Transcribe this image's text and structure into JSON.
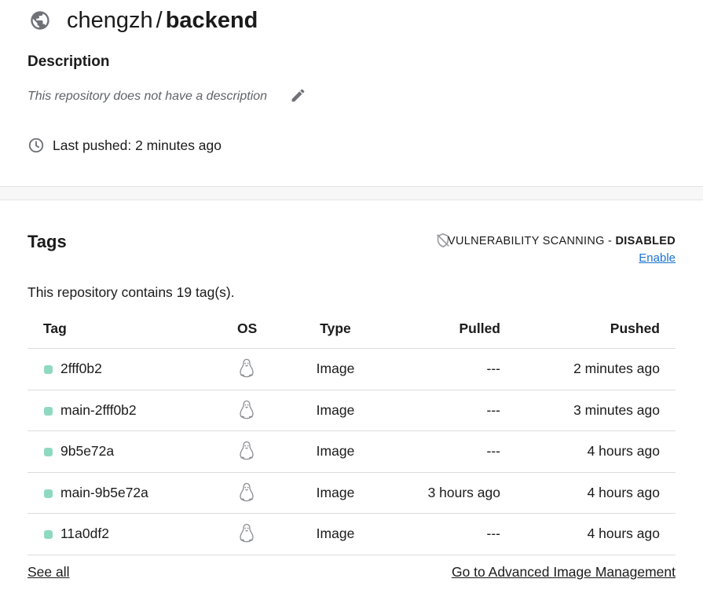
{
  "repo": {
    "namespace": "chengzh",
    "separator": "/",
    "name": "backend"
  },
  "description": {
    "heading": "Description",
    "text": "This repository does not have a description"
  },
  "last_pushed": "Last pushed: 2 minutes ago",
  "tags_section": {
    "heading": "Tags",
    "vulnerability_label": "VULNERABILITY SCANNING - ",
    "vulnerability_status": "DISABLED",
    "enable_link": "Enable",
    "count_text": "This repository contains 19 tag(s).",
    "columns": {
      "tag": "Tag",
      "os": "OS",
      "type": "Type",
      "pulled": "Pulled",
      "pushed": "Pushed"
    },
    "rows": [
      {
        "tag": "2fff0b2",
        "os_icon": "linux-icon",
        "type": "Image",
        "pulled": "---",
        "pushed": "2 minutes ago"
      },
      {
        "tag": "main-2fff0b2",
        "os_icon": "linux-icon",
        "type": "Image",
        "pulled": "---",
        "pushed": "3 minutes ago"
      },
      {
        "tag": "9b5e72a",
        "os_icon": "linux-icon",
        "type": "Image",
        "pulled": "---",
        "pushed": "4 hours ago"
      },
      {
        "tag": "main-9b5e72a",
        "os_icon": "linux-icon",
        "type": "Image",
        "pulled": "3 hours ago",
        "pushed": "4 hours ago"
      },
      {
        "tag": "11a0df2",
        "os_icon": "linux-icon",
        "type": "Image",
        "pulled": "---",
        "pushed": "4 hours ago"
      }
    ],
    "see_all": "See all",
    "advanced_link": "Go to Advanced Image Management"
  },
  "colors": {
    "tag_dot": "#8fd9c0",
    "link": "#1a73d1",
    "icon_gray": "#6f7177"
  }
}
